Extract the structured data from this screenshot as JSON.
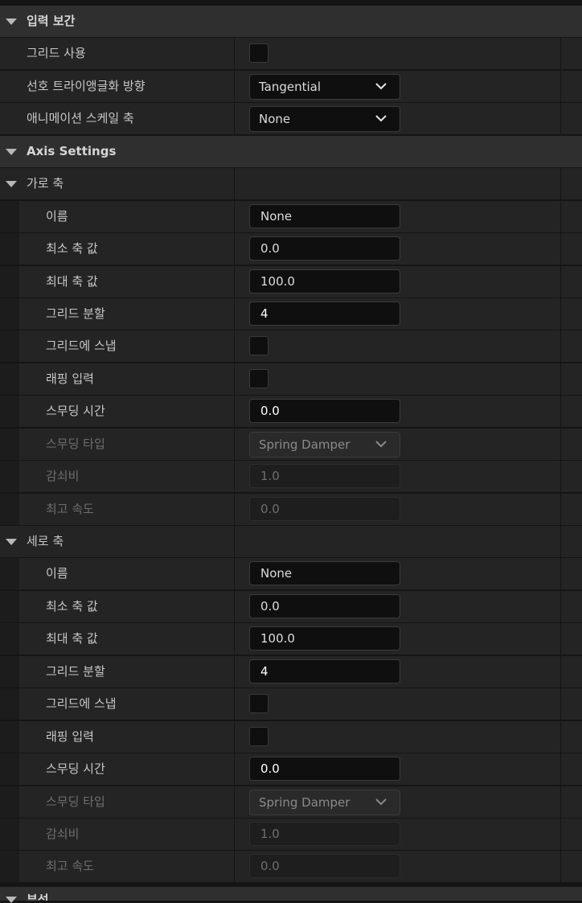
{
  "sections": {
    "input_interp": {
      "title": "입력 보간"
    },
    "axis_settings": {
      "title": "Axis Settings"
    },
    "next_section": {
      "title": "부석"
    }
  },
  "top": {
    "grid_use": {
      "label": "그리드 사용",
      "checked": false
    },
    "pref_triangulation": {
      "label": "선호 트라이앵글화 방향",
      "value": "Tangential"
    },
    "anim_scale_axis": {
      "label": "애니메이션 스케일 축",
      "value": "None"
    }
  },
  "horizontal": {
    "title": "가로 축",
    "name": {
      "label": "이름",
      "value": "None"
    },
    "min": {
      "label": "최소 축 값",
      "value": "0.0"
    },
    "max": {
      "label": "최대 축 값",
      "value": "100.0"
    },
    "grid_div": {
      "label": "그리드 분할",
      "value": "4"
    },
    "snap": {
      "label": "그리드에 스냅",
      "checked": false
    },
    "wrap": {
      "label": "래핑 입력",
      "checked": false
    },
    "smooth_time": {
      "label": "스무딩 시간",
      "value": "0.0"
    },
    "smooth_type": {
      "label": "스무딩 타입",
      "value": "Spring Damper"
    },
    "damping": {
      "label": "감쇠비",
      "value": "1.0"
    },
    "max_speed": {
      "label": "최고 속도",
      "value": "0.0"
    }
  },
  "vertical": {
    "title": "세로 축",
    "name": {
      "label": "이름",
      "value": "None"
    },
    "min": {
      "label": "최소 축 값",
      "value": "0.0"
    },
    "max": {
      "label": "최대 축 값",
      "value": "100.0"
    },
    "grid_div": {
      "label": "그리드 분할",
      "value": "4"
    },
    "snap": {
      "label": "그리드에 스냅",
      "checked": false
    },
    "wrap": {
      "label": "래핑 입력",
      "checked": false
    },
    "smooth_time": {
      "label": "스무딩 시간",
      "value": "0.0"
    },
    "smooth_type": {
      "label": "스무딩 타입",
      "value": "Spring Damper"
    },
    "damping": {
      "label": "감쇠비",
      "value": "1.0"
    },
    "max_speed": {
      "label": "최고 속도",
      "value": "0.0"
    }
  },
  "icons": {
    "expand": "triangle-down-icon",
    "dropdown": "chevron-down-icon"
  }
}
